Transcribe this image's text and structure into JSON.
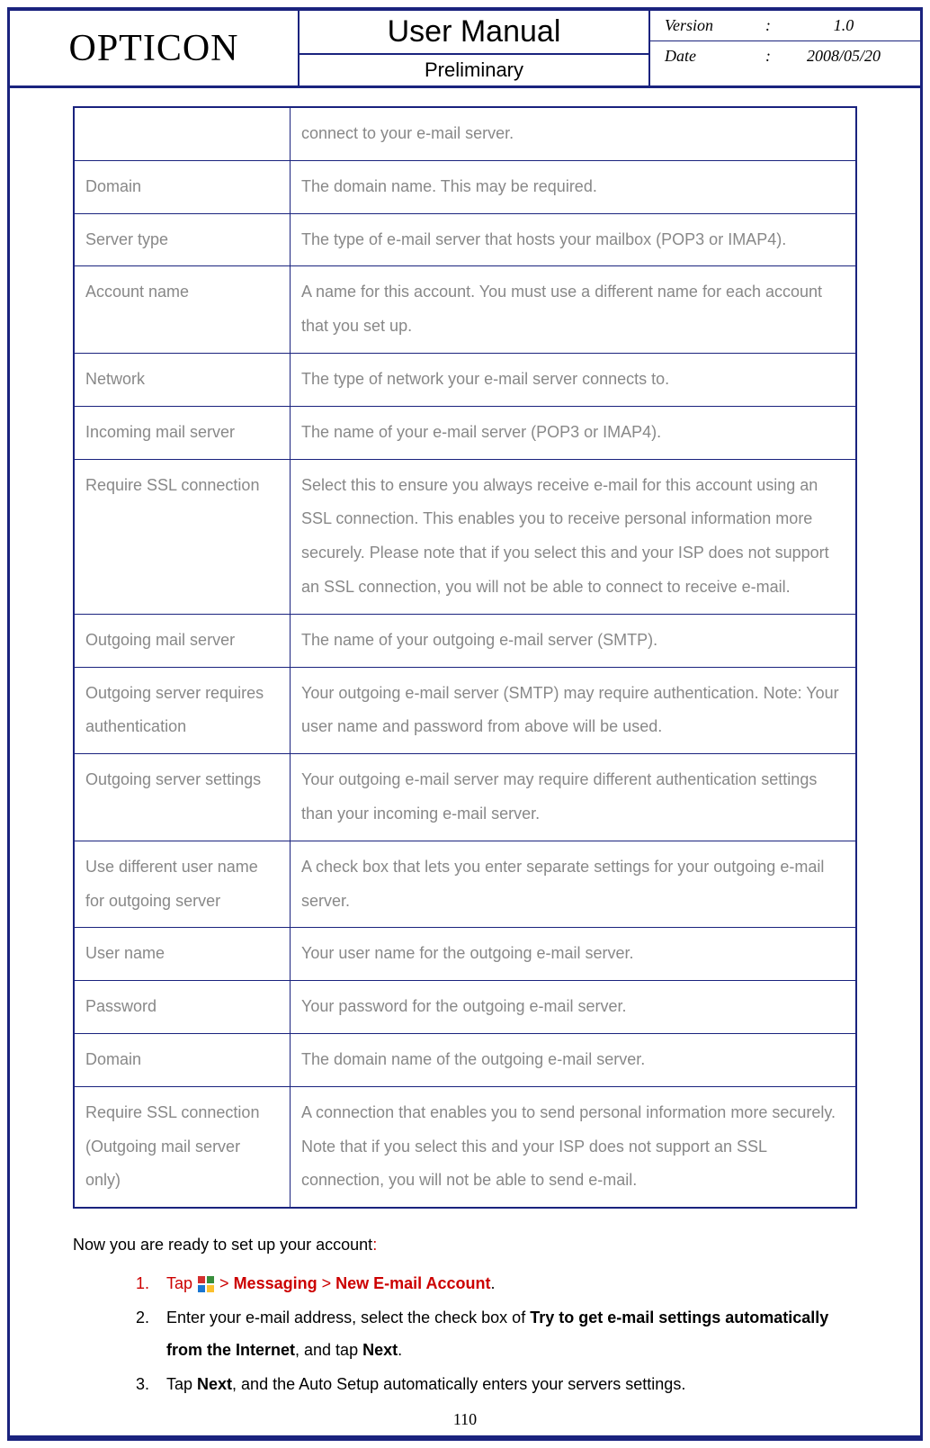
{
  "header": {
    "brand": "OPTICON",
    "title": "User Manual",
    "subtitle": "Preliminary",
    "version_label": "Version",
    "version_value": "1.0",
    "date_label": "Date",
    "date_value": "2008/05/20"
  },
  "table": {
    "rows": [
      {
        "term": "",
        "desc": "connect to your e-mail server."
      },
      {
        "term": "Domain",
        "desc": "The domain name. This may be required."
      },
      {
        "term": "Server type",
        "desc": "The type of e-mail server that hosts your mailbox (POP3 or IMAP4)."
      },
      {
        "term": "Account name",
        "desc": "A name for this account. You must use a different name for each account that you set up."
      },
      {
        "term": "Network",
        "desc": "The type of network your e-mail server connects to."
      },
      {
        "term": "Incoming mail server",
        "desc": "The name of your e-mail server (POP3 or IMAP4)."
      },
      {
        "term": "Require SSL connection",
        "desc": "Select this to ensure you always receive e-mail for this account using an SSL connection. This enables you to receive personal information more securely. Please note that if you select this and your ISP does not support an SSL connection, you will not be able to connect to receive e-mail."
      },
      {
        "term": "Outgoing mail server",
        "desc": "The name of your outgoing e-mail server (SMTP)."
      },
      {
        "term": "Outgoing server requires authentication",
        "desc": "Your outgoing e-mail server (SMTP) may require authentication. Note: Your user name and password from above will be used."
      },
      {
        "term": "Outgoing server settings",
        "desc": "Your outgoing e-mail server may require different authentication settings than your incoming e-mail server."
      },
      {
        "term": "Use different user name for outgoing server",
        "desc": "A check box that lets you enter separate settings for your outgoing e-mail server."
      },
      {
        "term": "User name",
        "desc": "Your user name for the outgoing e-mail server."
      },
      {
        "term": "Password",
        "desc": "Your password for the outgoing e-mail server."
      },
      {
        "term": "Domain",
        "desc": "The domain name of the outgoing e-mail server."
      },
      {
        "term": "Require SSL connection (Outgoing mail server only)",
        "desc": "A connection that enables you to send personal information more securely. Note that if you select this and your ISP does not support an SSL connection, you will not be able to send e-mail."
      }
    ]
  },
  "section": {
    "intro": "Now you are ready to set up your account",
    "colon": ":",
    "step1_tap": "Tap ",
    "step1_gt1": " > ",
    "step1_messaging": "Messaging",
    "step1_gt2": " > ",
    "step1_newemail": "New E-mail Account",
    "step1_period": ".",
    "step2_a": "Enter your e-mail address, select the check box of ",
    "step2_bold": "Try to get e-mail settings automatically from the Internet",
    "step2_b": ", and tap ",
    "step2_next": "Next",
    "step2_period": ".",
    "step3_a": "Tap ",
    "step3_next": "Next",
    "step3_b": ", and the Auto Setup automatically enters your servers settings."
  },
  "page_number": "110"
}
